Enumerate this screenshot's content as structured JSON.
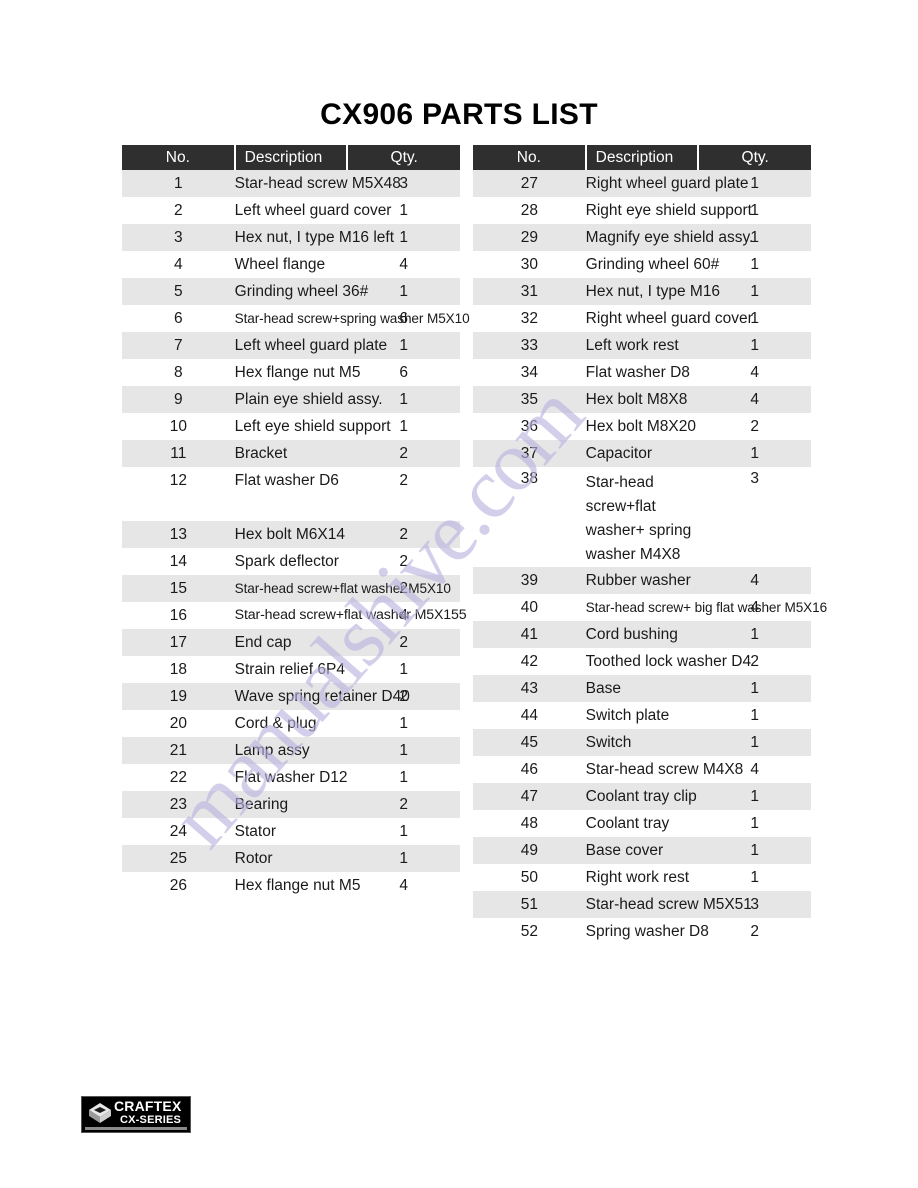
{
  "document": {
    "title": "CX906 PARTS LIST",
    "watermark": "manualshive.com"
  },
  "table": {
    "headers": {
      "no": "No.",
      "description": "Description",
      "qty": "Qty."
    }
  },
  "left_column": [
    {
      "no": "1",
      "description": "Star-head screw M5X48",
      "qty": "3"
    },
    {
      "no": "2",
      "description": "Left wheel guard cover",
      "qty": "1"
    },
    {
      "no": "3",
      "description": "Hex nut, I type M16 left",
      "qty": "1"
    },
    {
      "no": "4",
      "description": "Wheel flange",
      "qty": "4"
    },
    {
      "no": "5",
      "description": "Grinding wheel 36#",
      "qty": "1"
    },
    {
      "no": "6",
      "description": "Star-head screw+spring washer M5X10",
      "qty": "6"
    },
    {
      "no": "7",
      "description": "Left wheel guard plate",
      "qty": "1"
    },
    {
      "no": "8",
      "description": "Hex flange nut M5",
      "qty": "6"
    },
    {
      "no": "9",
      "description": "Plain eye shield assy.",
      "qty": "1"
    },
    {
      "no": "10",
      "description": "Left eye shield support",
      "qty": "1"
    },
    {
      "no": "11",
      "description": "Bracket",
      "qty": "2"
    },
    {
      "no": "12",
      "description": "Flat washer D6",
      "qty": "2"
    },
    {
      "no": "13",
      "description": "Hex bolt M6X14",
      "qty": "2"
    },
    {
      "no": "14",
      "description": "Spark deflector",
      "qty": "2"
    },
    {
      "no": "15",
      "description": "Star-head screw+flat washer M5X10",
      "qty": "2"
    },
    {
      "no": "16",
      "description": "Star-head screw+flat washer M5X155",
      "qty": "4"
    },
    {
      "no": "17",
      "description": "End cap",
      "qty": "2"
    },
    {
      "no": "18",
      "description": "Strain relief 6P4",
      "qty": "1"
    },
    {
      "no": "19",
      "description": "Wave spring retainer D40",
      "qty": "2"
    },
    {
      "no": "20",
      "description": "Cord & plug",
      "qty": "1"
    },
    {
      "no": "21",
      "description": "Lamp assy",
      "qty": "1"
    },
    {
      "no": "22",
      "description": "Flat washer D12",
      "qty": "1"
    },
    {
      "no": "23",
      "description": "Bearing",
      "qty": "2"
    },
    {
      "no": "24",
      "description": "Stator",
      "qty": "1"
    },
    {
      "no": "25",
      "description": "Rotor",
      "qty": "1"
    },
    {
      "no": "26",
      "description": "Hex flange nut M5",
      "qty": "4"
    }
  ],
  "right_column": [
    {
      "no": "27",
      "description": "Right wheel guard plate",
      "qty": "1"
    },
    {
      "no": "28",
      "description": "Right eye shield support",
      "qty": "1"
    },
    {
      "no": "29",
      "description": "Magnify eye shield assy.",
      "qty": "1"
    },
    {
      "no": "30",
      "description": "Grinding wheel 60#",
      "qty": "1"
    },
    {
      "no": "31",
      "description": "Hex nut, I type M16",
      "qty": "1"
    },
    {
      "no": "32",
      "description": "Right wheel guard cover",
      "qty": "1"
    },
    {
      "no": "33",
      "description": "Left work rest",
      "qty": "1"
    },
    {
      "no": "34",
      "description": "Flat washer D8",
      "qty": "4"
    },
    {
      "no": "35",
      "description": "Hex bolt M8X8",
      "qty": "4"
    },
    {
      "no": "36",
      "description": "Hex bolt M8X20",
      "qty": "2"
    },
    {
      "no": "37",
      "description": "Capacitor",
      "qty": "1"
    },
    {
      "no": "38",
      "description": "Star-head screw+flat washer+ spring washer M4X8",
      "qty": "3"
    },
    {
      "no": "39",
      "description": "Rubber washer",
      "qty": "4"
    },
    {
      "no": "40",
      "description": "Star-head screw+ big flat washer M5X16",
      "qty": "4"
    },
    {
      "no": "41",
      "description": "Cord bushing",
      "qty": "1"
    },
    {
      "no": "42",
      "description": "Toothed lock washer D4",
      "qty": "2"
    },
    {
      "no": "43",
      "description": "Base",
      "qty": "1"
    },
    {
      "no": "44",
      "description": "Switch plate",
      "qty": "1"
    },
    {
      "no": "45",
      "description": "Switch",
      "qty": "1"
    },
    {
      "no": "46",
      "description": "Star-head screw M4X8",
      "qty": "4"
    },
    {
      "no": "47",
      "description": "Coolant tray clip",
      "qty": "1"
    },
    {
      "no": "48",
      "description": "Coolant tray",
      "qty": "1"
    },
    {
      "no": "49",
      "description": "Base cover",
      "qty": "1"
    },
    {
      "no": "50",
      "description": "Right work rest",
      "qty": "1"
    },
    {
      "no": "51",
      "description": "Star-head screw M5X51",
      "qty": "3"
    },
    {
      "no": "52",
      "description": "Spring washer D8",
      "qty": "2"
    }
  ],
  "logo": {
    "brand": "CRAFTEX",
    "series": "CX-SERIES"
  }
}
